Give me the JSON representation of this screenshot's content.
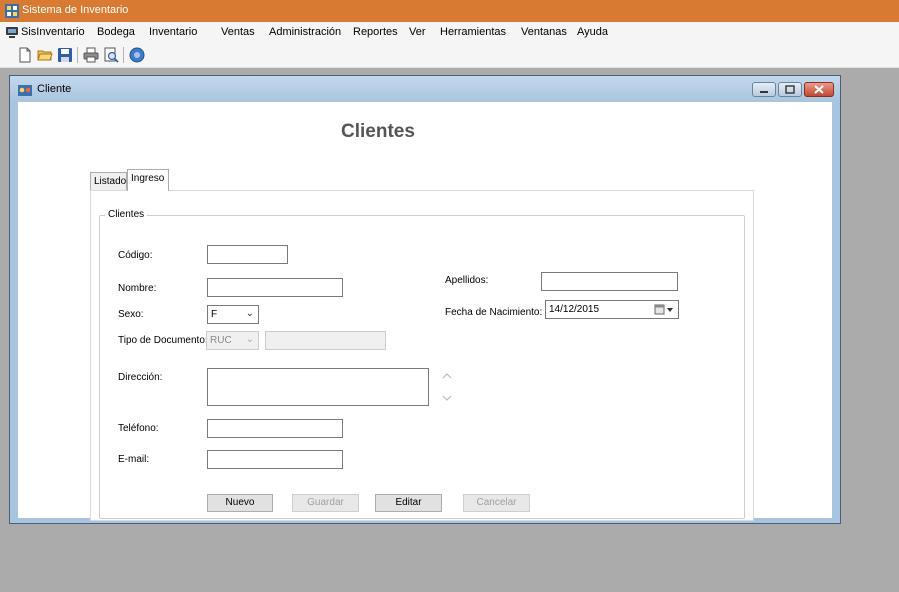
{
  "app": {
    "title": "Sistema de Inventario",
    "accent_color": "#d97a32"
  },
  "menu": {
    "items": [
      {
        "label": "SisInventario",
        "icon": "app-icon"
      },
      {
        "label": "Bodega"
      },
      {
        "label": "Inventario"
      },
      {
        "label": "Ventas"
      },
      {
        "label": "Administración"
      },
      {
        "label": "Reportes"
      },
      {
        "label": "Ver"
      },
      {
        "label": "Herramientas"
      },
      {
        "label": "Ventanas"
      },
      {
        "label": "Ayuda"
      }
    ]
  },
  "toolbar": {
    "icons": [
      "new-document-icon",
      "open-folder-icon",
      "save-icon",
      "print-icon",
      "print-preview-icon",
      "help-icon"
    ]
  },
  "child_window": {
    "title": "Cliente"
  },
  "form": {
    "heading": "Clientes",
    "tabs": [
      {
        "label": "Listado",
        "active": false
      },
      {
        "label": "Ingreso",
        "active": true
      }
    ],
    "group_title": "Clientes",
    "fields": {
      "codigo": {
        "label": "Código:",
        "value": ""
      },
      "nombre": {
        "label": "Nombre:",
        "value": ""
      },
      "apellidos": {
        "label": "Apellidos:",
        "value": ""
      },
      "sexo": {
        "label": "Sexo:",
        "value": "F"
      },
      "fecha_nacimiento": {
        "label": "Fecha de Nacimiento:",
        "value": "14/12/2015"
      },
      "tipo_documento": {
        "label": "Tipo de Documento:",
        "value": "RUC",
        "number": ""
      },
      "direccion": {
        "label": "Dirección:",
        "value": ""
      },
      "telefono": {
        "label": "Teléfono:",
        "value": ""
      },
      "email": {
        "label": "E-mail:",
        "value": ""
      }
    },
    "buttons": {
      "nuevo": {
        "label": "Nuevo",
        "enabled": true
      },
      "guardar": {
        "label": "Guardar",
        "enabled": false
      },
      "editar": {
        "label": "Editar",
        "enabled": true
      },
      "cancelar": {
        "label": "Cancelar",
        "enabled": false
      }
    }
  }
}
